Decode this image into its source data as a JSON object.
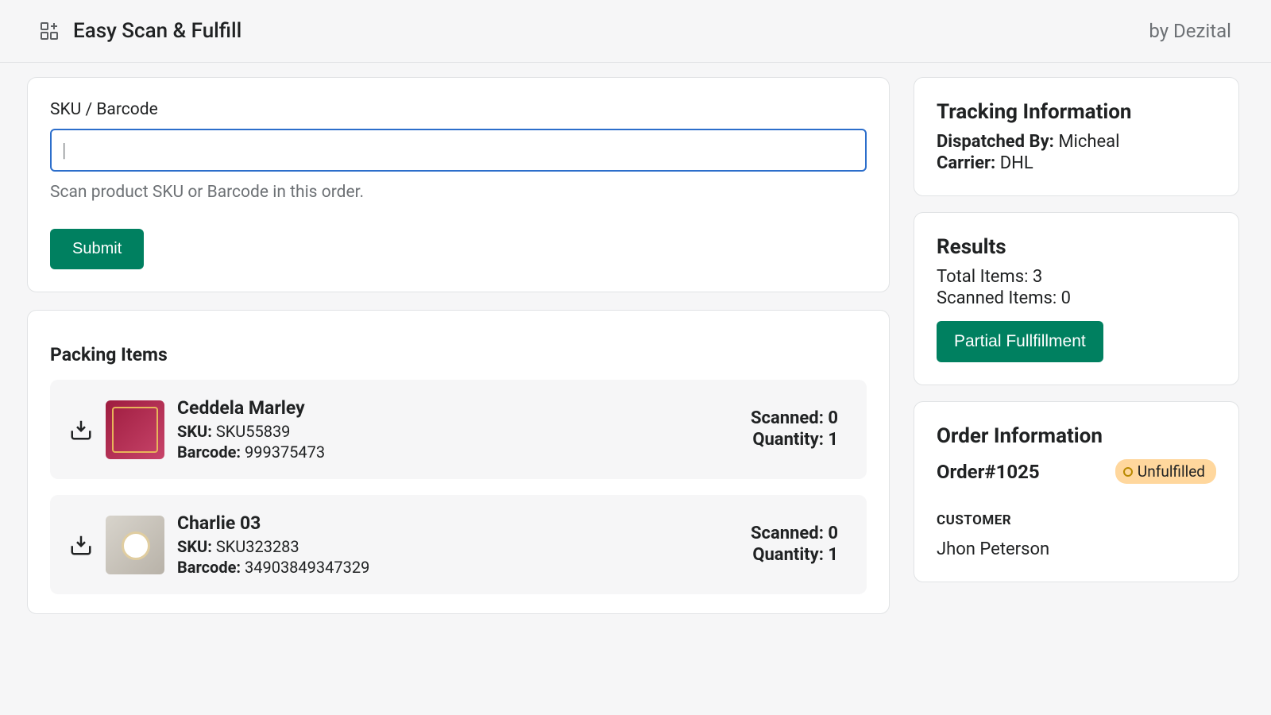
{
  "header": {
    "app_title": "Easy Scan & Fulfill",
    "by_line": "by Dezital"
  },
  "scan": {
    "label": "SKU / Barcode",
    "value": "",
    "helper": "Scan product SKU or Barcode in this order.",
    "submit_label": "Submit"
  },
  "packing": {
    "title": "Packing Items",
    "sku_label": "SKU:",
    "barcode_label": "Barcode:",
    "scanned_label": "Scanned:",
    "quantity_label": "Quantity:",
    "items": [
      {
        "name": "Ceddela Marley",
        "sku": "SKU55839",
        "barcode": "999375473",
        "scanned": "0",
        "quantity": "1"
      },
      {
        "name": "Charlie 03",
        "sku": "SKU323283",
        "barcode": "34903849347329",
        "scanned": "0",
        "quantity": "1"
      }
    ]
  },
  "tracking": {
    "title": "Tracking Information",
    "dispatched_label": "Dispatched By:",
    "dispatched_value": "Micheal",
    "carrier_label": "Carrier:",
    "carrier_value": "DHL"
  },
  "results": {
    "title": "Results",
    "total_label": "Total Items:",
    "total_value": "3",
    "scanned_label": "Scanned Items:",
    "scanned_value": "0",
    "action_label": "Partial Fullfillment"
  },
  "order": {
    "title": "Order Information",
    "order_number": "Order#1025",
    "status": "Unfulfilled",
    "customer_label": "CUSTOMER",
    "customer_name": "Jhon Peterson"
  }
}
